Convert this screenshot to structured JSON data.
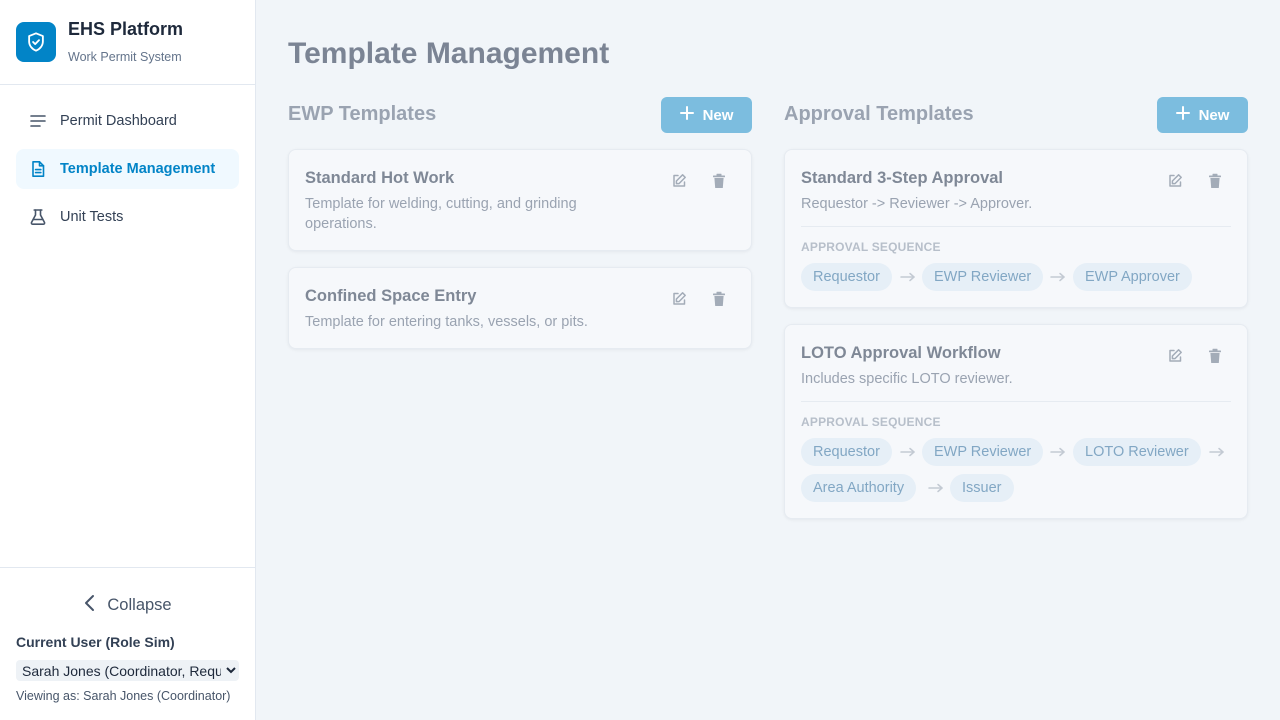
{
  "brand": {
    "title": "EHS Platform",
    "subtitle": "Work Permit System",
    "logo_icon": "shield-check-icon",
    "color": "#0284c7"
  },
  "nav": {
    "items": [
      {
        "label": "Permit Dashboard",
        "icon": "list-icon",
        "active": false
      },
      {
        "label": "Template Management",
        "icon": "document-icon",
        "active": true
      },
      {
        "label": "Unit Tests",
        "icon": "beaker-icon",
        "active": false
      }
    ]
  },
  "footer": {
    "collapse_label": "Collapse",
    "current_user_label": "Current User (Role Sim)",
    "current_user_value": "Sarah Jones (Coordinator, Requestor)",
    "viewing_as": "Viewing as: Sarah Jones (Coordinator)"
  },
  "page": {
    "title": "Template Management"
  },
  "ewp": {
    "heading": "EWP Templates",
    "new_label": "New",
    "templates": [
      {
        "title": "Standard Hot Work",
        "description_line1": "Template for welding, cutting, and grinding",
        "description_line2": "operations."
      },
      {
        "title": "Confined Space Entry",
        "description_line1": "Template for entering tanks, vessels, or pits."
      }
    ]
  },
  "approval": {
    "heading": "Approval Templates",
    "new_label": "New",
    "sequence_label": "APPROVAL SEQUENCE",
    "templates": [
      {
        "title": "Standard 3-Step Approval",
        "description": "Requestor -> Reviewer -> Approver.",
        "sequence": [
          "Requestor",
          "EWP Reviewer",
          "EWP Approver"
        ]
      },
      {
        "title": "LOTO Approval Workflow",
        "description": "Includes specific LOTO reviewer.",
        "sequence": [
          "Requestor",
          "EWP Reviewer",
          "LOTO Reviewer",
          "Area Authority",
          "Issuer"
        ]
      }
    ]
  },
  "colors": {
    "accent": "#0284c7",
    "new_button": "#7cbddf",
    "chip_bg": "#e6eff7",
    "chip_text": "#82a7c4",
    "background": "#f1f5f9"
  }
}
